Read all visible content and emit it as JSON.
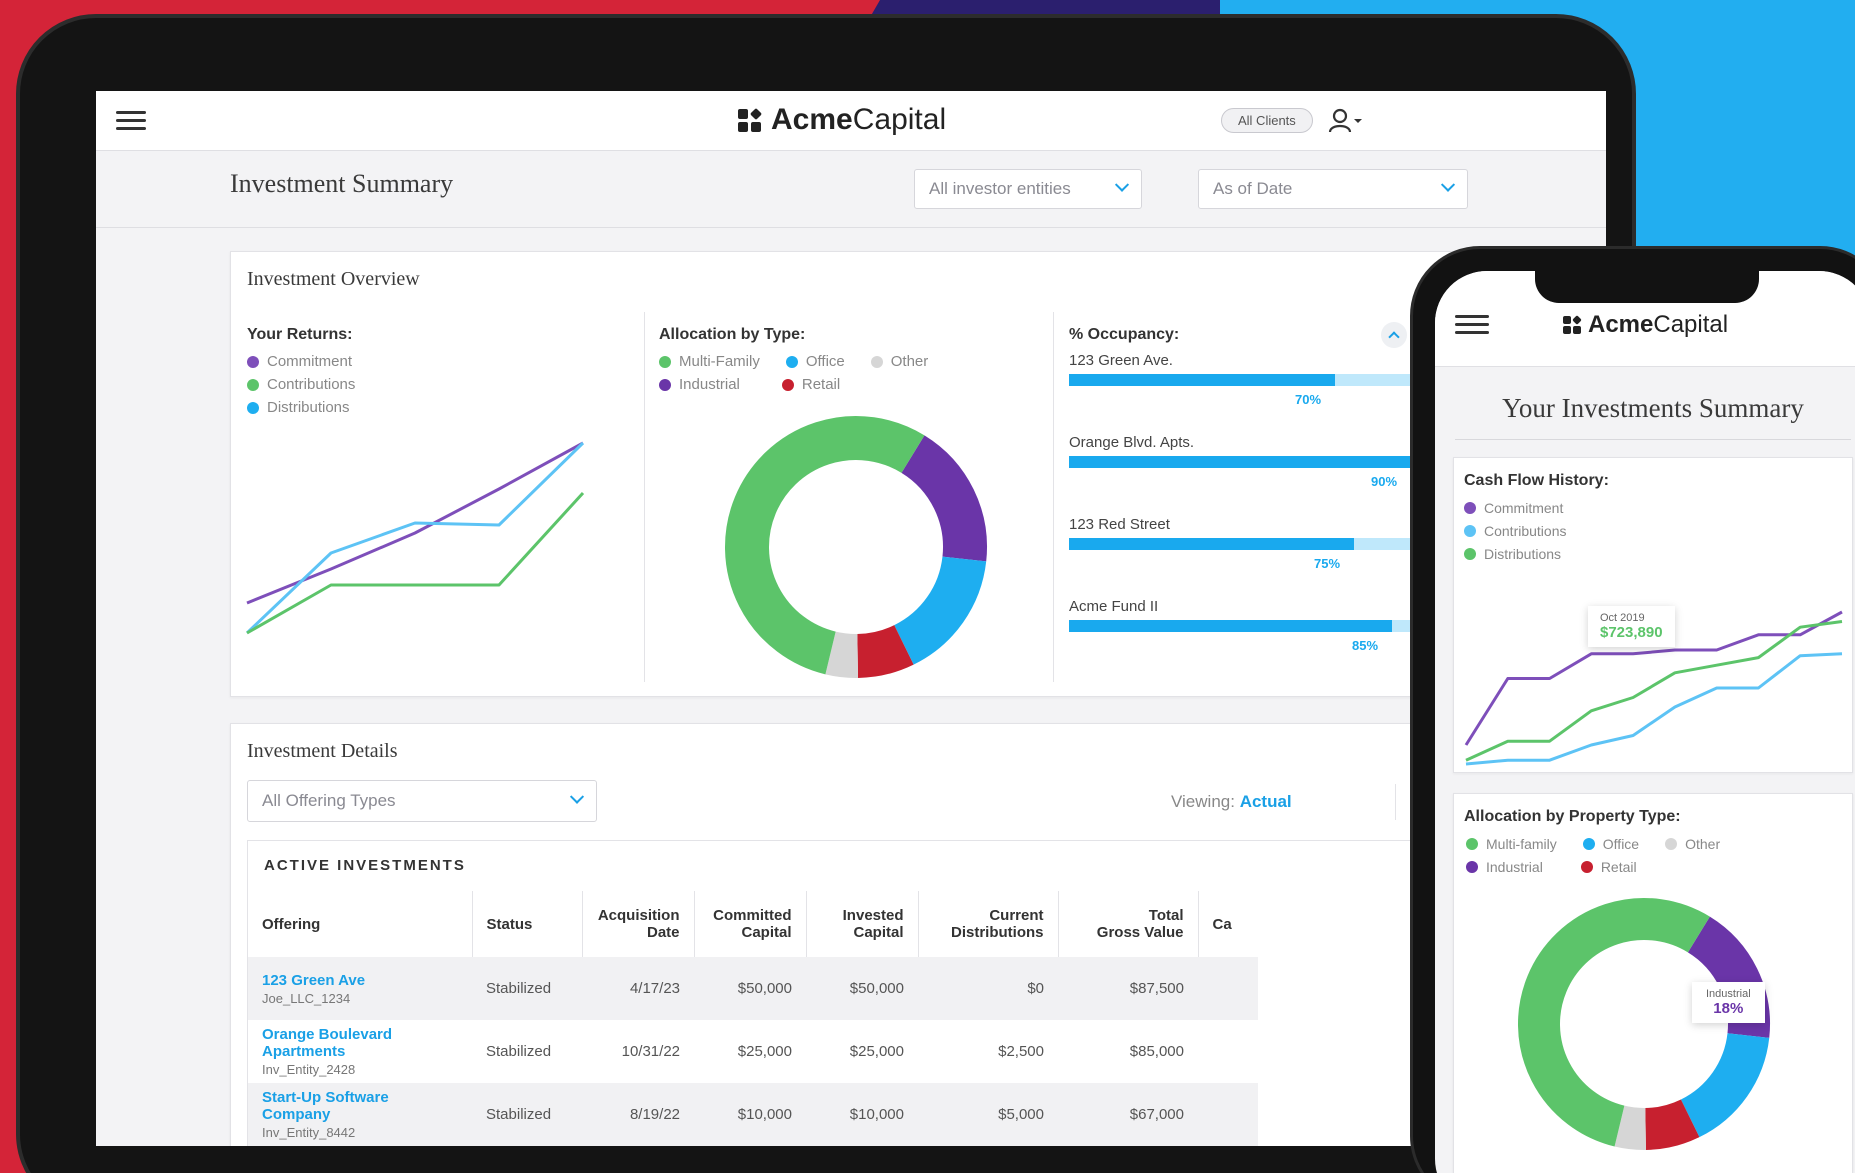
{
  "colors": {
    "commitment": "#7e4fba",
    "contributions": "#5dc3f5",
    "distributions": "#5cc46a",
    "multi_family": "#5cc46a",
    "office": "#1eaef0",
    "other": "#d6d6d6",
    "industrial": "#6a35a8",
    "retail": "#c7202f",
    "accent": "#1aa0e6"
  },
  "tablet": {
    "brand_bold": "Acme",
    "brand_light": "Capital",
    "all_clients": "All Clients",
    "page_title": "Investment Summary",
    "entity_select": "All investor entities",
    "date_select": "As of Date",
    "overview": {
      "title": "Investment Overview",
      "returns_label": "Your Returns:",
      "returns_legend": [
        "Commitment",
        "Contributions",
        "Distributions"
      ],
      "allocation_label": "Allocation by Type:",
      "allocation_legend_row1": [
        "Multi-Family",
        "Office",
        "Other"
      ],
      "allocation_legend_row2": [
        "Industrial",
        "Retail"
      ],
      "occupancy_label": "% Occupancy:",
      "occupancy": [
        {
          "name": "123 Green Ave.",
          "pct_label": "70%",
          "value": 70
        },
        {
          "name": "Orange Blvd. Apts.",
          "pct_label": "90%",
          "value": 90
        },
        {
          "name": "123 Red Street",
          "pct_label": "75%",
          "value": 75
        },
        {
          "name": "Acme Fund II",
          "pct_label": "85%",
          "value": 85
        }
      ]
    },
    "details": {
      "title": "Investment Details",
      "offering_select": "All Offering Types",
      "viewing_label": "Viewing:",
      "viewing_value": "Actual",
      "active_label": "ACTIVE INVESTMENTS",
      "columns": [
        {
          "l1": "",
          "l2": "Offering"
        },
        {
          "l1": "",
          "l2": "Status"
        },
        {
          "l1": "Acquisition",
          "l2": "Date"
        },
        {
          "l1": "Committed",
          "l2": "Capital"
        },
        {
          "l1": "Invested",
          "l2": "Capital"
        },
        {
          "l1": "Current",
          "l2": "Distributions"
        },
        {
          "l1": "Total",
          "l2": "Gross Value"
        },
        {
          "l1": "",
          "l2": "Ca"
        }
      ],
      "rows": [
        {
          "offering": "123 Green Ave",
          "entity": "Joe_LLC_1234",
          "status": "Stabilized",
          "date": "4/17/23",
          "committed": "$50,000",
          "invested": "$50,000",
          "distributions": "$0",
          "gross": "$87,500"
        },
        {
          "offering": "Orange Boulevard Apartments",
          "entity": "Inv_Entity_2428",
          "status": "Stabilized",
          "date": "10/31/22",
          "committed": "$25,000",
          "invested": "$25,000",
          "distributions": "$2,500",
          "gross": "$85,000"
        },
        {
          "offering": "Start-Up Software Company",
          "entity": "Inv_Entity_8442",
          "status": "Stabilized",
          "date": "8/19/22",
          "committed": "$10,000",
          "invested": "$10,000",
          "distributions": "$5,000",
          "gross": "$67,000"
        }
      ]
    }
  },
  "phone": {
    "brand_bold": "Acme",
    "brand_light": "Capital",
    "title": "Your Investments Summary",
    "cashflow_label": "Cash Flow History:",
    "cashflow_legend": [
      "Commitment",
      "Contributions",
      "Distributions"
    ],
    "tooltip_date": "Oct 2019",
    "tooltip_value": "$723,890",
    "allocation_label": "Allocation by Property Type:",
    "allocation_legend_row1": [
      "Multi-family",
      "Office",
      "Other"
    ],
    "allocation_legend_row2": [
      "Industrial",
      "Retail"
    ],
    "donut_tooltip_label": "Industrial",
    "donut_tooltip_value": "18%"
  },
  "chart_data": [
    {
      "type": "line",
      "series": [
        {
          "name": "Commitment",
          "values": [
            15,
            32,
            50,
            72,
            95
          ]
        },
        {
          "name": "Contributions",
          "values": [
            0,
            40,
            55,
            54,
            95
          ]
        },
        {
          "name": "Distributions",
          "values": [
            0,
            24,
            24,
            24,
            70
          ]
        }
      ],
      "x": [
        0,
        1,
        2,
        3,
        4
      ]
    },
    {
      "type": "pie",
      "categories": [
        "Multi-Family",
        "Industrial",
        "Office",
        "Retail",
        "Other"
      ],
      "values": [
        55,
        18,
        16,
        7,
        4
      ]
    },
    {
      "type": "bar",
      "title": "% Occupancy:",
      "categories": [
        "123 Green Ave.",
        "Orange Blvd. Apts.",
        "123 Red Street",
        "Acme Fund II"
      ],
      "values": [
        70,
        90,
        75,
        85
      ]
    },
    {
      "type": "line",
      "title": "Cash Flow History:",
      "series": [
        {
          "name": "Commitment",
          "values": [
            10,
            45,
            45,
            58,
            58,
            60,
            60,
            68,
            68,
            80
          ]
        },
        {
          "name": "Contributions",
          "values": [
            0,
            2,
            2,
            10,
            15,
            30,
            40,
            40,
            57,
            58
          ]
        },
        {
          "name": "Distributions",
          "values": [
            2,
            12,
            12,
            28,
            35,
            48,
            52,
            56,
            72,
            75
          ]
        }
      ],
      "x": [
        0,
        1,
        2,
        3,
        4,
        5,
        6,
        7,
        8,
        9
      ]
    }
  ]
}
